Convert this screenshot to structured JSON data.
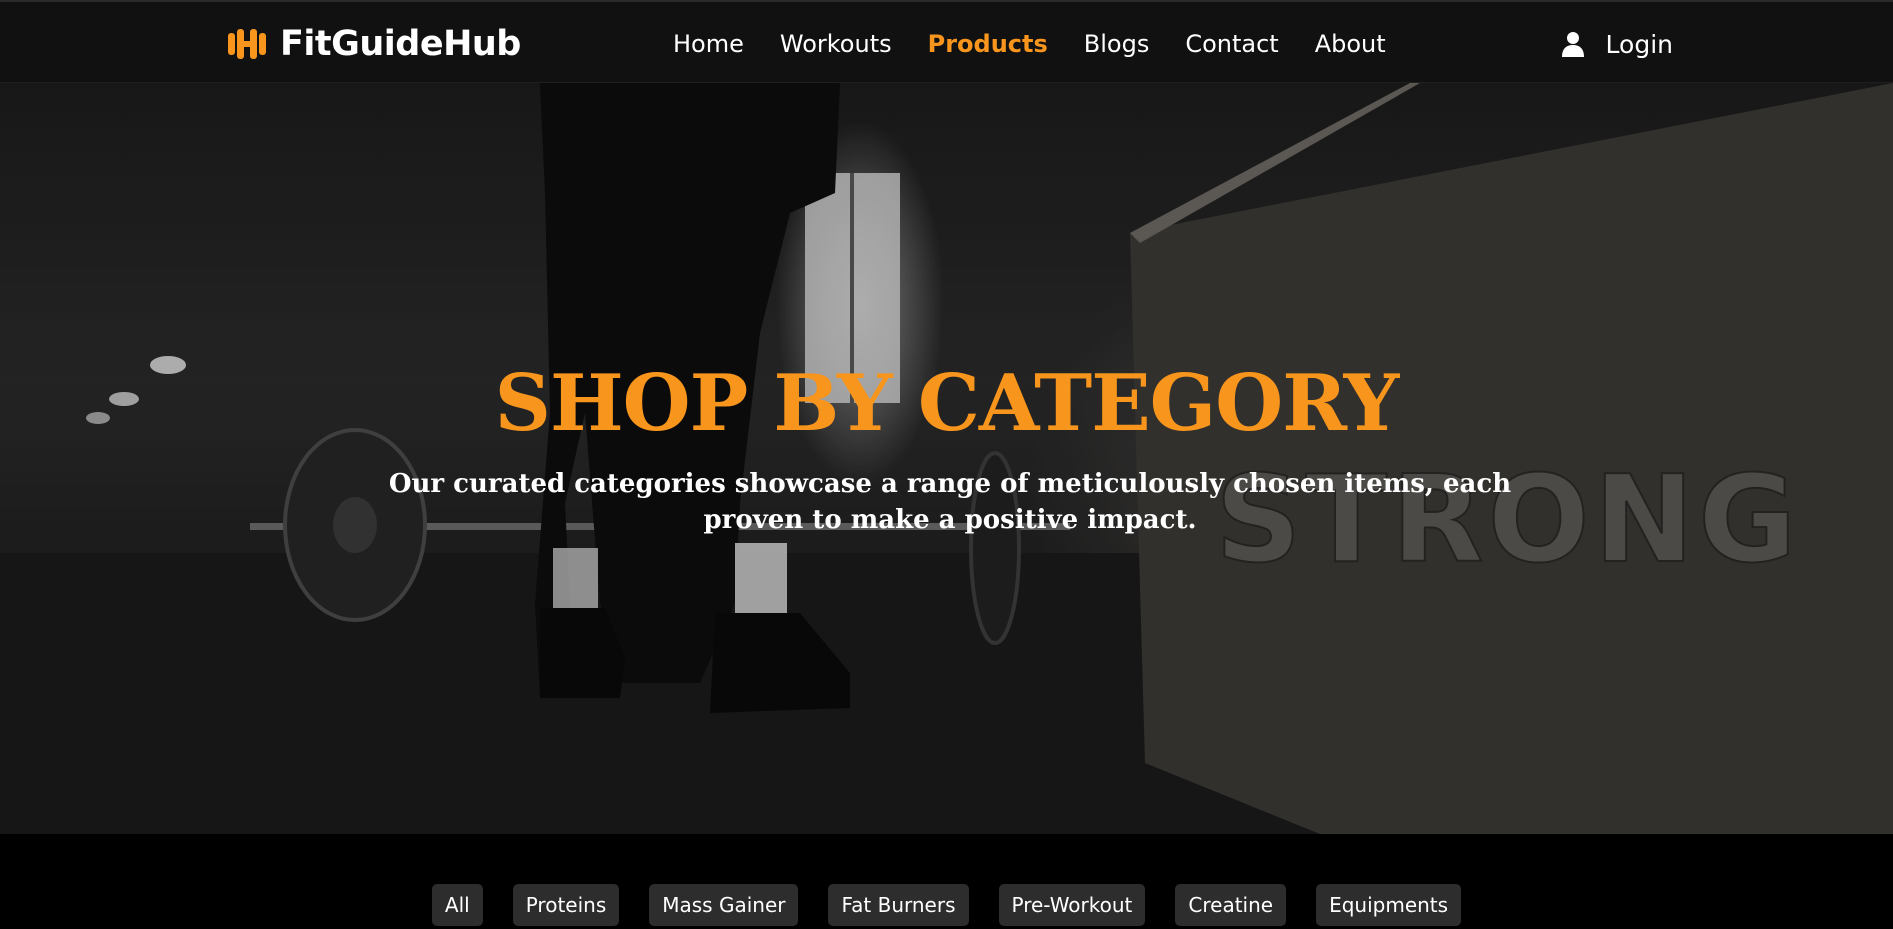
{
  "brand": {
    "name": "FitGuideHub",
    "icon": "dumbbell-icon",
    "accent": "#f7951d"
  },
  "nav": {
    "items": [
      {
        "label": "Home"
      },
      {
        "label": "Workouts"
      },
      {
        "label": "Products",
        "active": true
      },
      {
        "label": "Blogs"
      },
      {
        "label": "Contact"
      },
      {
        "label": "About"
      }
    ],
    "login_label": "Login",
    "login_icon": "user-icon"
  },
  "hero": {
    "title": "SHOP BY CATEGORY",
    "subtitle": "Our curated categories showcase a range of meticulously chosen items, each proven to make a positive impact."
  },
  "categories": [
    "All",
    "Proteins",
    "Mass Gainer",
    "Fat Burners",
    "Pre-Workout",
    "Creatine",
    "Equipments"
  ],
  "colors": {
    "accent": "#f7951d",
    "navbar_bg": "#111111",
    "pill_bg": "#2d2d2d"
  }
}
